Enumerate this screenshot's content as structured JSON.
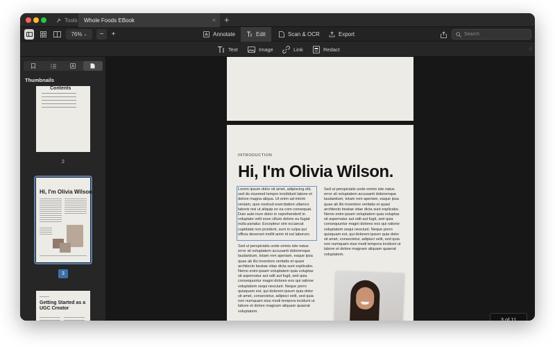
{
  "titlebar": {
    "tools_label": "Tools",
    "document_tab": "Whole Foods EBook",
    "close_glyph": "×",
    "new_tab_glyph": "+"
  },
  "toolbar": {
    "zoom": "76%",
    "zoom_out": "−",
    "zoom_in": "+",
    "modes": {
      "annotate": "Annotate",
      "edit": "Edit",
      "scan": "Scan & OCR",
      "export": "Export"
    },
    "search_placeholder": "Search"
  },
  "edit_tools": {
    "text": "Text",
    "image": "Image",
    "link": "Link",
    "redact": "Redact"
  },
  "sidebar": {
    "title": "Thumbnails",
    "thumbnails": [
      {
        "number": "2",
        "title": "Contents"
      },
      {
        "number": "3",
        "title": "Hi, I'm Olivia Wilson."
      },
      {
        "number": "",
        "title": "Getting Started as a UGC Creator"
      }
    ]
  },
  "page": {
    "intro": "INTRODUCTION",
    "heading": "Hi, I'm Olivia Wilson.",
    "para1": "Lorem ipsum dolor sit amet, adipiscing elit, sed do eiusmod tempor incididunt labore et dolore magna aliqua. Ut enim ad minim veniam, quis nostrud exercitation ullamco laboris nisi ut aliquip ex ea com consequat. Duis aute irure dolor in reprehenderit in voluptate velit esse cillum dolore eu fugiat nulla pariatur. Excepteur sint occaecat cupidatat non proident, sunt in culpa qui officia deserunt mollit anim id est laborum.",
    "para2": "Sed ut perspiciatis unde omnis iste natus error sit voluptatem accusanti doloremque laudantium, totam rem aperiam, eaque ipsa quae ab illo inventore veritatis et quasi architecto beatae vitae dicta sunt explicabo. Nemo enim ipsam voluptatem quia voluptas sit aspernatur aut odit aut fugit, sed quia consequuntur magni dolores eos qui ratione voluptatem sequi nesciunt. Neque porro quisquam est, qui dolorem ipsum quia dolor sit amet, consectetur, adipisci velit, sed quia non numquam eius modi tempora incidunt ut labore et dolore magnam aliquam quaerat voluptatem.",
    "para3": "Sed ut perspiciatis unde omnis iste natus error sit voluptatem accusanti doloremque laudantium, totam rem aperiam, eaque ipsa quae ab illo inventore veritatis et quasi architecto beatae vitae dicta sunt explicabo. Nemo enim ipsam voluptatem quia voluptas sit aspernatur aut odit aut fugit, sed quia consequuntur magni dolores eos qui ratione voluptatem sequi nesciunt. Neque porro quisquam est, qui dolorem ipsum quia dolor sit amet, consectetur, adipisci velit, sed quia non numquam eius modi tempora incidunt ut labore et dolore magnam aliquam quaerat voluptatem."
  },
  "page_indicator": "3 of 11",
  "colors": {
    "accent": "#3d6fa8",
    "page": "#ecebe6",
    "canvas": "#171717"
  }
}
